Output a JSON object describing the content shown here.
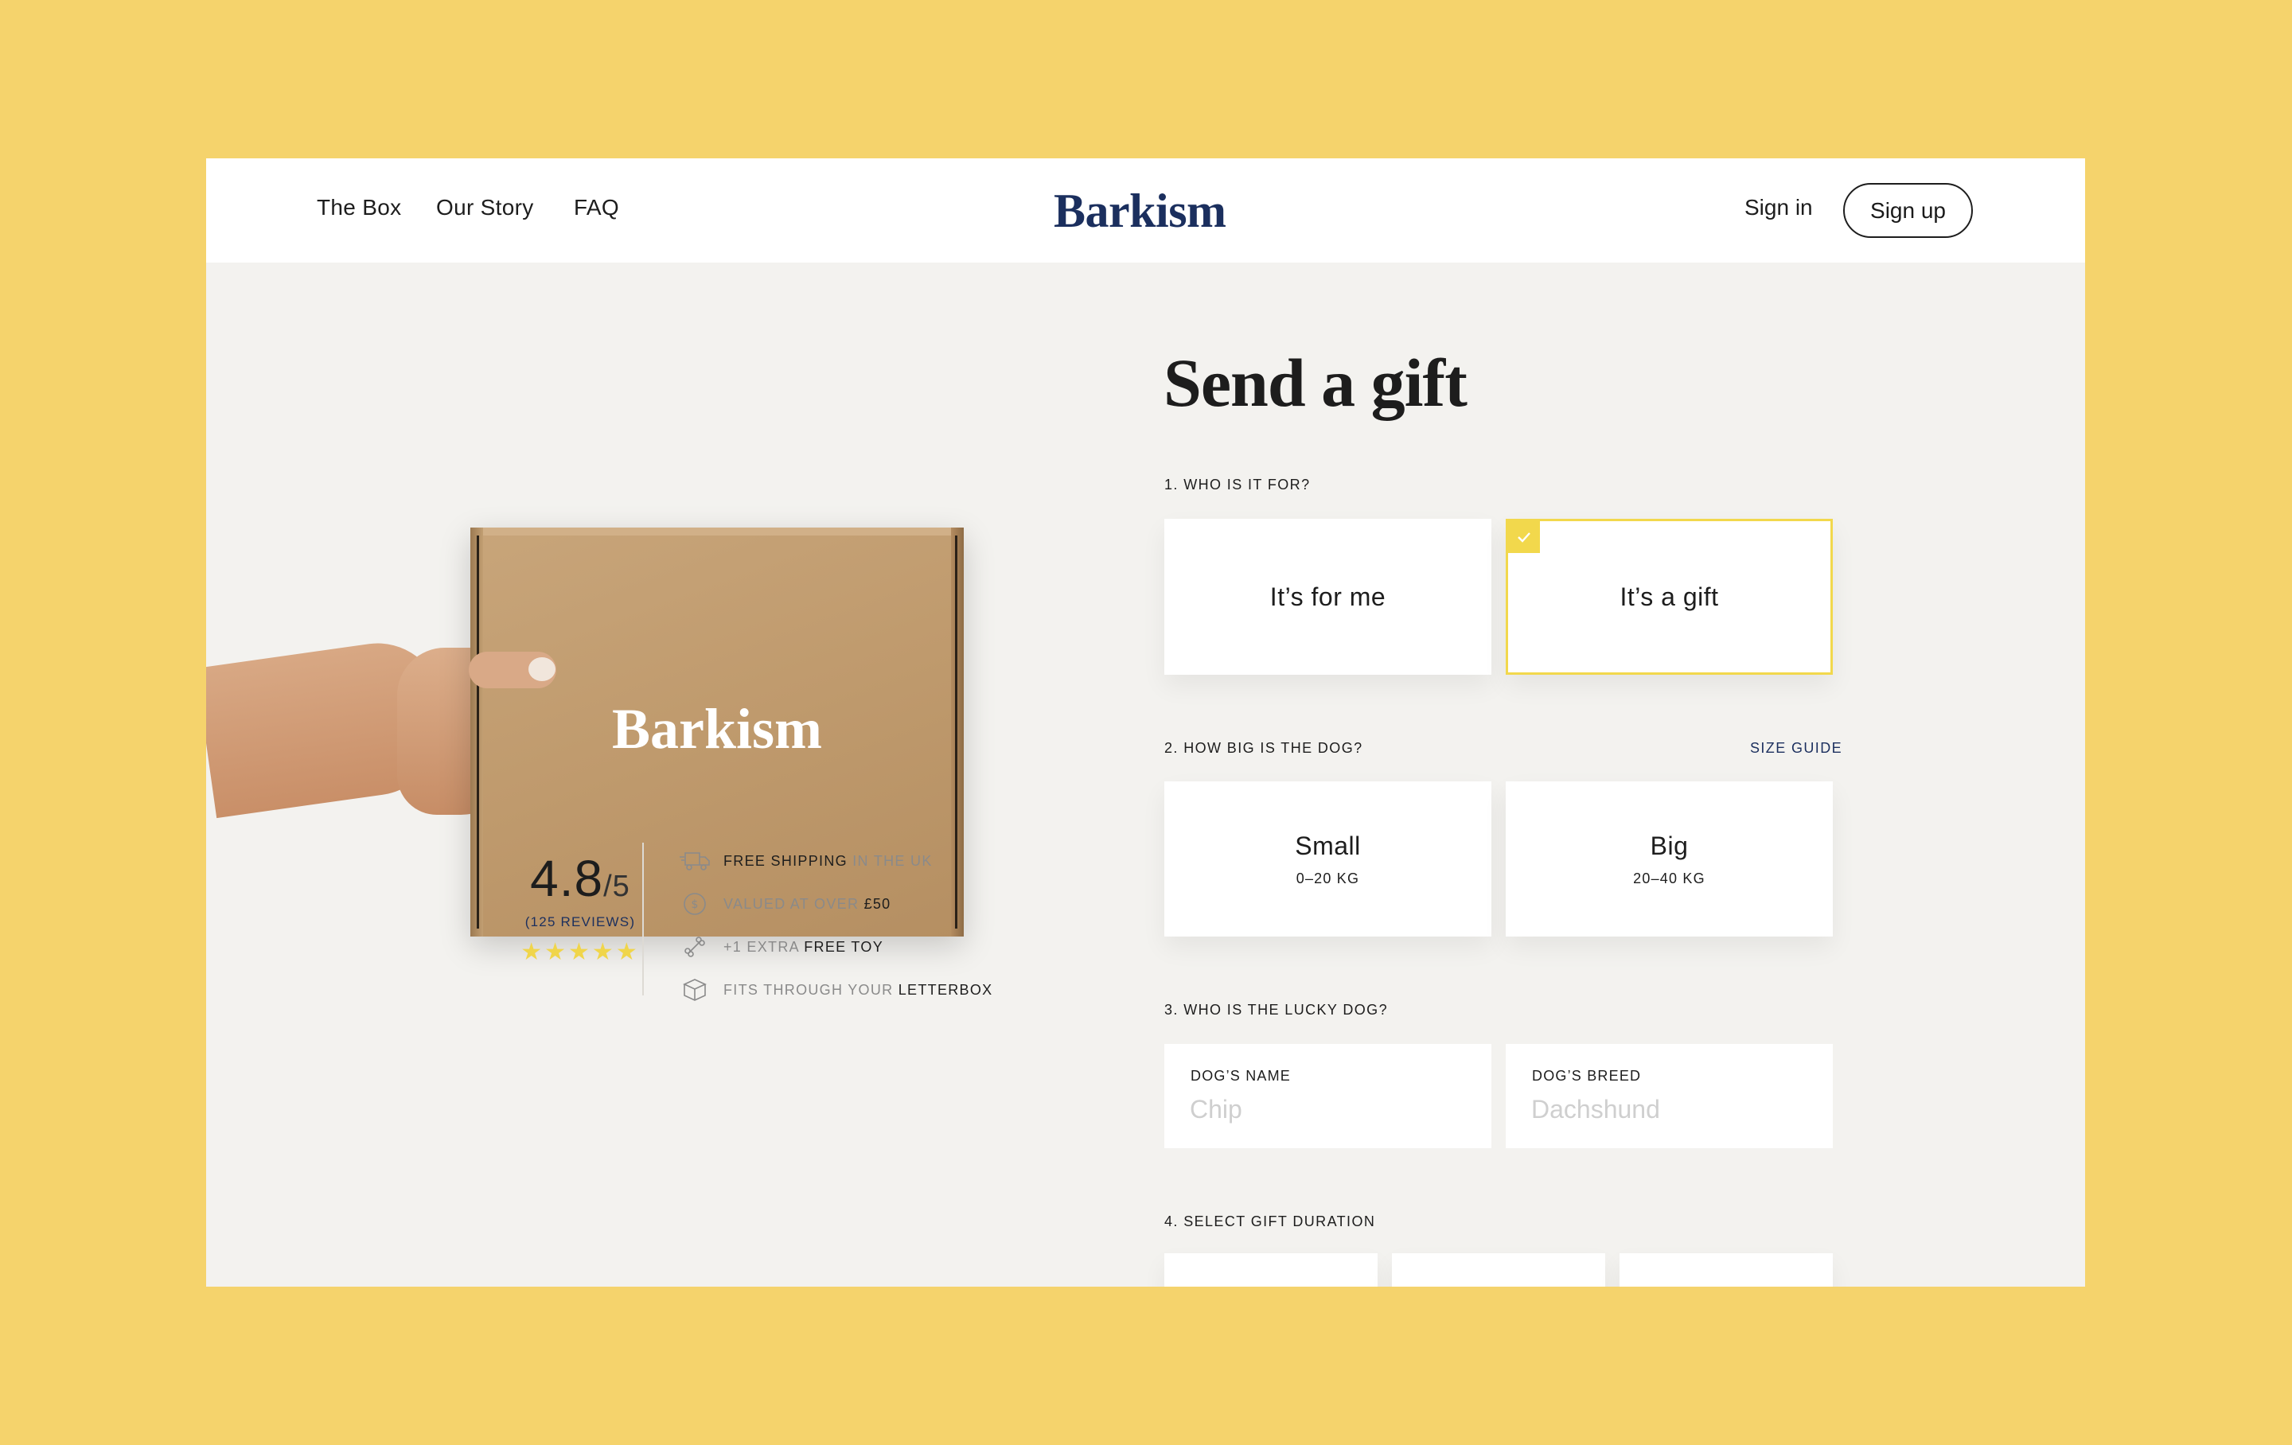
{
  "header": {
    "nav": [
      "The Box",
      "Our Story",
      "FAQ"
    ],
    "logo": "Barkism",
    "sign_in": "Sign in",
    "sign_up": "Sign up"
  },
  "product": {
    "box_logo": "Barkism",
    "rating_score": "4.8",
    "rating_out_of": "/5",
    "reviews": "(125 REVIEWS)",
    "stars": "★★★★★",
    "rating_value": 4.8,
    "perks": [
      {
        "icon": "truck-icon",
        "bold": "FREE SHIPPING",
        "rest": " IN THE UK"
      },
      {
        "icon": "coin-icon",
        "pre": "VALUED AT OVER ",
        "bold": "£50"
      },
      {
        "icon": "bone-icon",
        "pre": "+1 EXTRA ",
        "bold": "FREE TOY"
      },
      {
        "icon": "box-icon",
        "pre": "FITS THROUGH YOUR ",
        "bold": "LETTERBOX"
      }
    ]
  },
  "form": {
    "title": "Send a gift",
    "q1": "1. WHO IS IT FOR?",
    "q1_options": [
      "It’s for me",
      "It’s a gift"
    ],
    "q1_selected": "It’s a gift",
    "q2": "2. HOW BIG IS THE DOG?",
    "size_guide": "SIZE GUIDE",
    "sizes": [
      {
        "label": "Small",
        "range": "0–20 KG"
      },
      {
        "label": "Big",
        "range": "20–40 KG"
      }
    ],
    "q3": "3. WHO IS THE LUCKY DOG?",
    "dog_name_label": "DOG’S NAME",
    "dog_name_placeholder": "Chip",
    "dog_breed_label": "DOG’S BREED",
    "dog_breed_placeholder": "Dachshund",
    "q4": "4. SELECT GIFT DURATION"
  },
  "colors": {
    "background": "#F5D36C",
    "brand_navy": "#1B2F5E",
    "accent_yellow": "#F2D84C",
    "panel": "#F3F2EF"
  }
}
